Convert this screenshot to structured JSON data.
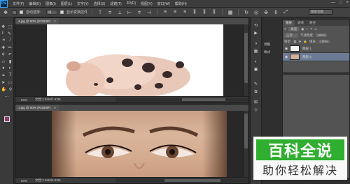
{
  "app": {
    "logo": "Ps",
    "menus": [
      "文件(F)",
      "编辑(E)",
      "图像(I)",
      "图层(L)",
      "文字(Y)",
      "选择(S)",
      "滤镜(T)",
      "3D(D)",
      "视图(V)",
      "窗口(W)",
      "帮助(H)"
    ],
    "window_controls": [
      "—",
      "□",
      "×"
    ]
  },
  "options": {
    "auto_select_label": "自动选择：",
    "auto_select_value": "组",
    "show_transform_label": "显示变换控件",
    "workspace": "基本功能"
  },
  "documents": [
    {
      "tab_title": "4.jpg @ 50% (RGB/8#)",
      "zoom": "50%",
      "doc_size": "文档:2.93M/2.93M"
    },
    {
      "tab_title": "1.jpg @ 50% (RGB/8#)",
      "zoom": "50%",
      "doc_size": "文档:2.93M/6.93M"
    }
  ],
  "mini_panel": {
    "items": [
      {
        "icon": "history-icon",
        "label": ""
      },
      {
        "icon": "actions-icon",
        "label": ""
      },
      {
        "icon": "color-icon",
        "label": ""
      },
      {
        "icon": "swatches-icon",
        "label": ""
      },
      {
        "icon": "adjust-icon",
        "label": "调整"
      },
      {
        "icon": "styles-icon",
        "label": "样式"
      },
      {
        "icon": "brush-icon",
        "label": ""
      },
      {
        "icon": "brush-presets-icon",
        "label": ""
      },
      {
        "icon": "channels-icon",
        "label": ""
      },
      {
        "icon": "paths-icon",
        "label": ""
      }
    ]
  },
  "layers_panel": {
    "tabs": [
      "图层",
      "通道",
      "路径"
    ],
    "kind_label": "类型",
    "blend_mode": "正常",
    "opacity_label": "不透明度:",
    "opacity_value": "100%",
    "lock_label": "锁定:",
    "fill_label": "填充:",
    "fill_value": "100%",
    "layers": [
      {
        "name": "图层 1",
        "selected": false
      },
      {
        "name": "图层 2",
        "selected": true
      }
    ]
  },
  "watermark": {
    "title": "百科全说",
    "subtitle": "助你轻松解决"
  },
  "colors": {
    "foreground": "#8a3b70",
    "background": "#000000",
    "watermark_green": "#2fae2f",
    "selected_layer": "#6b7b94"
  }
}
